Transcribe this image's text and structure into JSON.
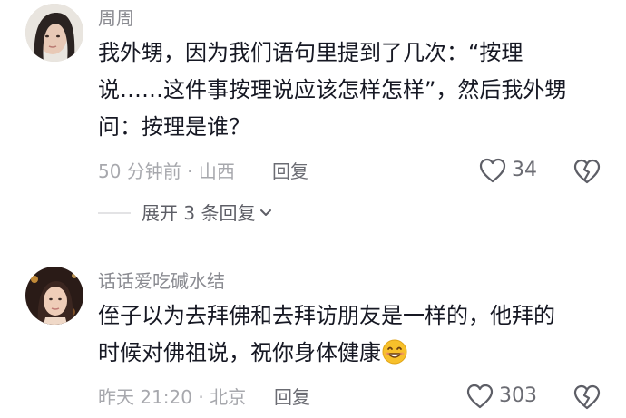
{
  "comments": [
    {
      "username": "周周",
      "text_lines": [
        "我外甥，因为我们语句里提到了几次：“按理",
        "说……这件事按理说应该怎样怎样”，然后我外甥",
        "问：按理是谁？"
      ],
      "meta": "50 分钟前 · 山西",
      "reply_label": "回复",
      "likes": "34",
      "expand_label": "展开 3 条回复"
    },
    {
      "username": "话话爱吃碱水结",
      "text_lines": [
        "侄子以为去拜佛和去拜访朋友是一样的，他拜的",
        "时候对佛祖说，祝你身体健康"
      ],
      "meta": "昨天 21:20 · 北京",
      "reply_label": "回复",
      "likes": "303"
    }
  ],
  "icons": {
    "like": "heart-outline-icon",
    "dislike": "broken-heart-icon",
    "expand": "chevron-down-icon",
    "emoji": "smiling-face-emoji-icon"
  },
  "colors": {
    "text": "#161823",
    "secondary": "#8a8b91",
    "emoji": "#f7c02b"
  }
}
